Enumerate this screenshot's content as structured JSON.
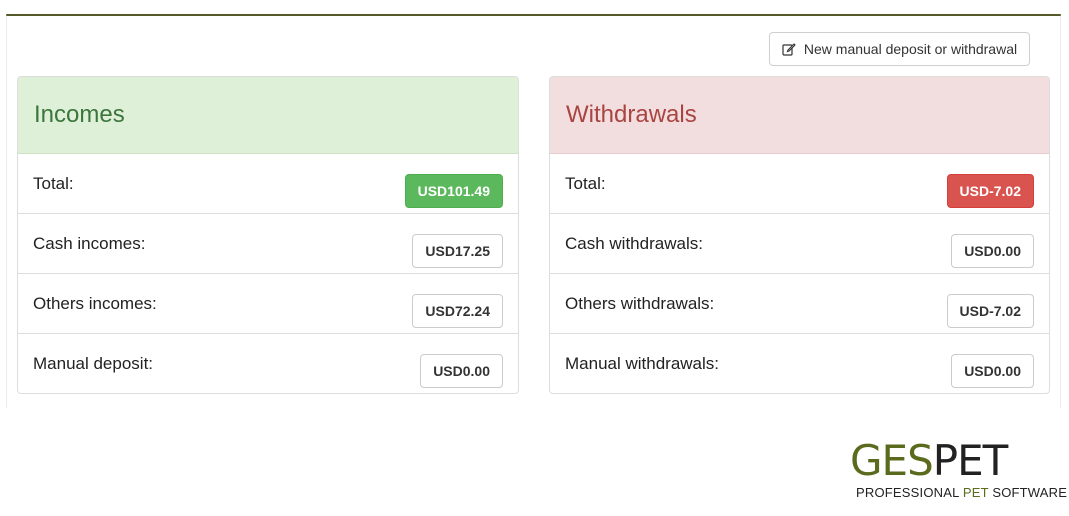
{
  "toolbar": {
    "new_label": "New manual deposit or withdrawal",
    "new_icon": "edit-icon"
  },
  "incomes": {
    "title": "Incomes",
    "rows": [
      {
        "label": "Total:",
        "amount": "USD101.49",
        "style": "success"
      },
      {
        "label": "Cash incomes:",
        "amount": "USD17.25",
        "style": "default"
      },
      {
        "label": "Others incomes:",
        "amount": "USD72.24",
        "style": "default"
      },
      {
        "label": "Manual deposit:",
        "amount": "USD0.00",
        "style": "default"
      }
    ]
  },
  "withdrawals": {
    "title": "Withdrawals",
    "rows": [
      {
        "label": "Total:",
        "amount": "USD-7.02",
        "style": "danger"
      },
      {
        "label": "Cash withdrawals:",
        "amount": "USD0.00",
        "style": "default"
      },
      {
        "label": "Others withdrawals:",
        "amount": "USD-7.02",
        "style": "default"
      },
      {
        "label": "Manual withdrawals:",
        "amount": "USD0.00",
        "style": "default"
      }
    ]
  },
  "logo": {
    "word_part1": "GES",
    "word_part2": "PET",
    "tag_part1": "PROFESSIONAL ",
    "tag_part2": "PET",
    "tag_part3": " SOFTWARE"
  },
  "colors": {
    "success": "#5cb85c",
    "danger": "#d9534f",
    "incomes_header_bg": "#dff0d8",
    "withdrawals_header_bg": "#f2dede",
    "brand_green": "#5b6b1e"
  }
}
